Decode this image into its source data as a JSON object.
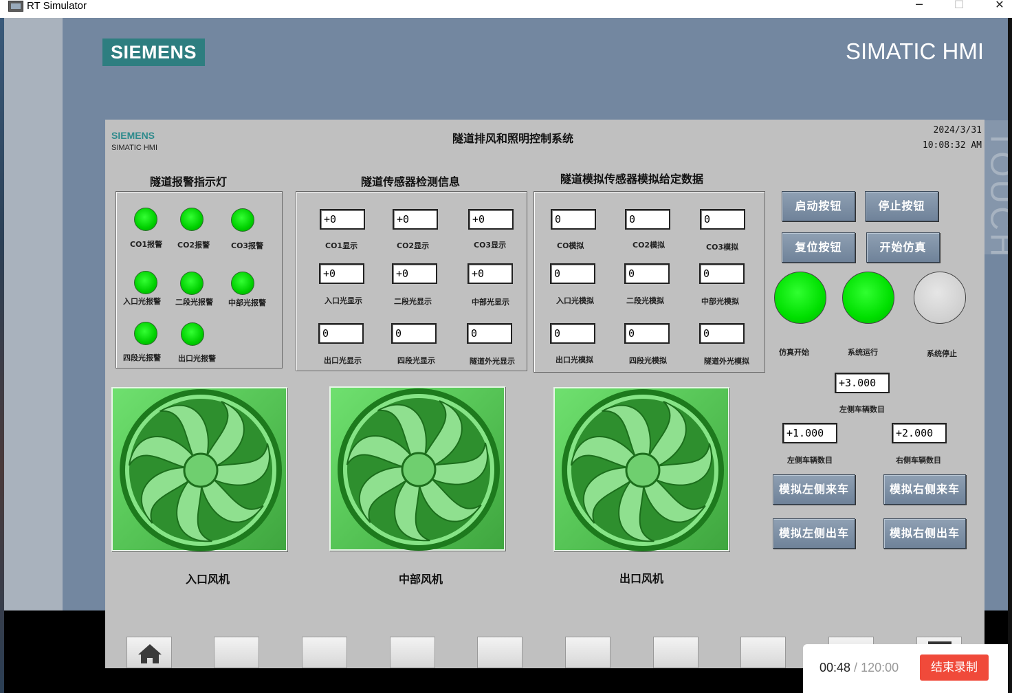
{
  "window": {
    "title": "RT Simulator",
    "minimize": "─",
    "maximize": "☐",
    "close": "✕"
  },
  "device": {
    "brand": "SIEMENS",
    "model": "SIMATIC HMI",
    "touch_text": "TOUCH"
  },
  "screen": {
    "logo": "SIEMENS",
    "logo_sub": "SIMATIC HMI",
    "title": "隧道排风和照明控制系统",
    "date": "2024/3/31",
    "time": "10:08:32 AM"
  },
  "alarm_panel": {
    "title": "隧道报警指示灯",
    "lamps": [
      "CO1报警",
      "CO2报警",
      "CO3报警",
      "入口光报警",
      "二段光报警",
      "中部光报警",
      "四段光报警",
      "出口光报警"
    ]
  },
  "sensor_panel": {
    "title": "隧道传感器检测信息",
    "fields": [
      {
        "label": "CO1显示",
        "value": "+0"
      },
      {
        "label": "CO2显示",
        "value": "+0"
      },
      {
        "label": "CO3显示",
        "value": "+0"
      },
      {
        "label": "入口光显示",
        "value": "+0"
      },
      {
        "label": "二段光显示",
        "value": "+0"
      },
      {
        "label": "中部光显示",
        "value": "+0"
      },
      {
        "label": "出口光显示",
        "value": "0"
      },
      {
        "label": "四段光显示",
        "value": "0"
      },
      {
        "label": "隧道外光显示",
        "value": "0"
      }
    ]
  },
  "sim_panel": {
    "title": "隧道模拟传感器模拟给定数据",
    "fields": [
      {
        "label": "CO模拟",
        "value": "0"
      },
      {
        "label": "CO2模拟",
        "value": "0"
      },
      {
        "label": "CO3模拟",
        "value": "0"
      },
      {
        "label": "入口光模拟",
        "value": "0"
      },
      {
        "label": "二段光模拟",
        "value": "0"
      },
      {
        "label": "中部光模拟",
        "value": "0"
      },
      {
        "label": "出口光模拟",
        "value": "0"
      },
      {
        "label": "四段光模拟",
        "value": "0"
      },
      {
        "label": "隧道外光模拟",
        "value": "0"
      }
    ]
  },
  "controls": {
    "start": "启动按钮",
    "stop": "停止按钮",
    "reset": "复位按钮",
    "begin_sim": "开始仿真",
    "status": [
      {
        "label": "仿真开始",
        "state": "on"
      },
      {
        "label": "系统运行",
        "state": "on"
      },
      {
        "label": "系统停止",
        "state": "off"
      }
    ],
    "total_value": "+3.000",
    "total_label": "左侧车辆数目",
    "left_value": "+1.000",
    "left_label": "左侧车辆数目",
    "right_value": "+2.000",
    "right_label": "右侧车辆数目",
    "sim_left_in": "模拟左侧来车",
    "sim_right_in": "模拟右侧来车",
    "sim_left_out": "模拟左侧出车",
    "sim_right_out": "模拟右侧出车"
  },
  "fans": [
    {
      "label": "入口风机"
    },
    {
      "label": "中部风机"
    },
    {
      "label": "出口风机"
    }
  ],
  "recorder": {
    "elapsed": "00:48",
    "separator": " / ",
    "total": "120:00",
    "stop_label": "结束录制"
  },
  "colors": {
    "lamp_on": "#00e000",
    "lamp_off": "#cfcfcf",
    "header": "#7387a0",
    "screen_bg": "#c0c0c0",
    "record_btn": "#f04a3a"
  }
}
